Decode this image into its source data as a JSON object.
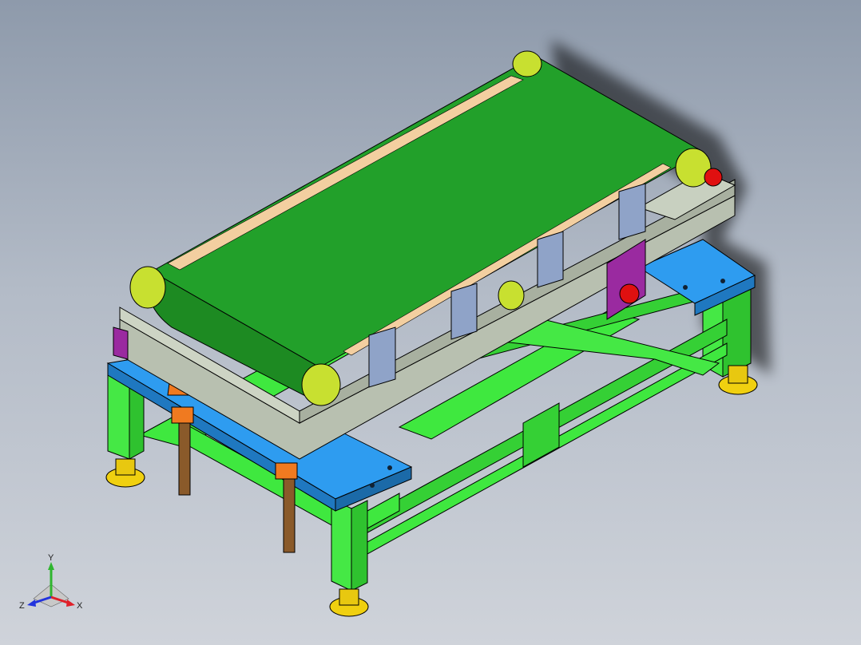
{
  "view": {
    "name": "cad-3d-viewport",
    "background": [
      "#8e9aab",
      "#cfd3da"
    ]
  },
  "triad": {
    "x_label": "X",
    "y_label": "Y",
    "z_label": "Z",
    "x_color": "#e0202a",
    "y_color": "#2fb52f",
    "z_color": "#2233dd"
  },
  "model": {
    "belt_color": "#22a02a",
    "frame_color": "#3fe83f",
    "plate_color": "#2e9cf0",
    "beam_color": "#b8c0b0",
    "bracket_color": "#8fa3c8",
    "purple_plate_color": "#9a2aa0",
    "foot_color": "#f0d010",
    "sprocket_color": "#e01010",
    "bearing_color": "#c8e030",
    "edge_strip_color": "#f3cfa0"
  }
}
